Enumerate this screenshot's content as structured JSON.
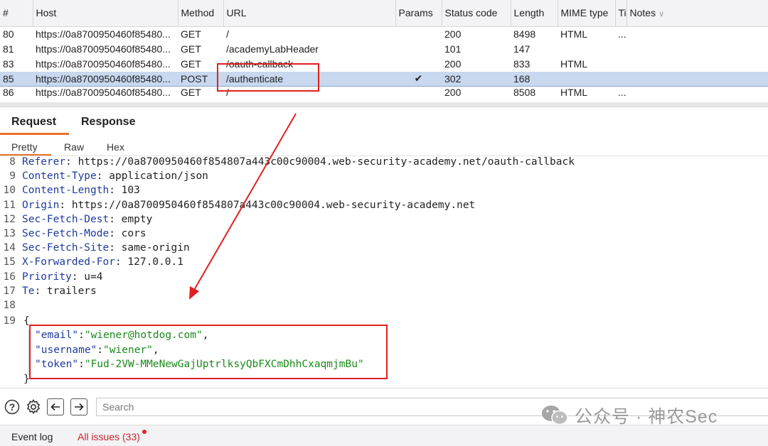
{
  "history": {
    "columns": [
      "#",
      "Host",
      "Method",
      "URL",
      "Params",
      "Status code",
      "Length",
      "MIME type",
      "Ti",
      "Notes"
    ],
    "rows": [
      {
        "num": "80",
        "host": "https://0a8700950460f85480...",
        "method": "GET",
        "url": "/",
        "params": "",
        "status": "200",
        "length": "8498",
        "mime": "HTML",
        "ti": "...",
        "selected": false
      },
      {
        "num": "81",
        "host": "https://0a8700950460f85480...",
        "method": "GET",
        "url": "/academyLabHeader",
        "params": "",
        "status": "101",
        "length": "147",
        "mime": "",
        "ti": "",
        "selected": false
      },
      {
        "num": "83",
        "host": "https://0a8700950460f85480...",
        "method": "GET",
        "url": "/oauth-callback",
        "params": "",
        "status": "200",
        "length": "833",
        "mime": "HTML",
        "ti": "",
        "selected": false
      },
      {
        "num": "85",
        "host": "https://0a8700950460f85480...",
        "method": "POST",
        "url": "/authenticate",
        "params": "✔",
        "status": "302",
        "length": "168",
        "mime": "",
        "ti": "",
        "selected": true
      },
      {
        "num": "86",
        "host": "https://0a8700950460f85480...",
        "method": "GET",
        "url": "/",
        "params": "",
        "status": "200",
        "length": "8508",
        "mime": "HTML",
        "ti": "...",
        "selected": false
      }
    ]
  },
  "tabs": {
    "request": "Request",
    "response": "Response"
  },
  "subtabs": {
    "pretty": "Pretty",
    "raw": "Raw",
    "hex": "Hex"
  },
  "editor": {
    "lines": [
      {
        "n": "8",
        "key": "Referer",
        "value": " https://0a8700950460f854807a443c00c90004.web-security-academy.net/oauth-callback"
      },
      {
        "n": "9",
        "key": "Content-Type",
        "value": " application/json"
      },
      {
        "n": "10",
        "key": "Content-Length",
        "value": " 103"
      },
      {
        "n": "11",
        "key": "Origin",
        "value": " https://0a8700950460f854807a443c00c90004.web-security-academy.net"
      },
      {
        "n": "12",
        "key": "Sec-Fetch-Dest",
        "value": " empty"
      },
      {
        "n": "13",
        "key": "Sec-Fetch-Mode",
        "value": " cors"
      },
      {
        "n": "14",
        "key": "Sec-Fetch-Site",
        "value": " same-origin"
      },
      {
        "n": "15",
        "key": "X-Forwarded-For",
        "value": " 127.0.0.1"
      },
      {
        "n": "16",
        "key": "Priority",
        "value": " u=4"
      },
      {
        "n": "17",
        "key": "Te",
        "value": " trailers"
      },
      {
        "n": "18",
        "key": "",
        "value": ""
      }
    ],
    "body_line_number": "19",
    "open_brace": "{",
    "close_brace": "}",
    "json": [
      {
        "key": "\"email\"",
        "value": "\"wiener@hotdog.com\"",
        "comma": ","
      },
      {
        "key": "\"username\"",
        "value": "\"wiener\"",
        "comma": ","
      },
      {
        "key": "\"token\"",
        "value": "\"Fud-2VW-MMeNewGajUptrlksyQbFXCmDhhCxaqmjmBu\"",
        "comma": ""
      }
    ]
  },
  "search": {
    "placeholder": "Search",
    "value": ""
  },
  "watermark": "公众号 · 神农Sec",
  "statusbar": {
    "event_log": "Event log",
    "all_issues": "All issues (33)"
  },
  "colors": {
    "accent": "#e8702a",
    "annotation": "#e02020",
    "selected_row": "#c7d8ef",
    "issues": "#c8232c"
  }
}
